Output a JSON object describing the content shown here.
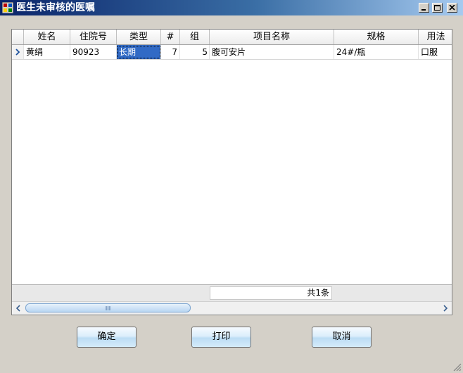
{
  "window": {
    "title": "医生未审核的医嘱"
  },
  "grid": {
    "columns": [
      {
        "key": "name",
        "label": "姓名"
      },
      {
        "key": "admission_no",
        "label": "住院号"
      },
      {
        "key": "type",
        "label": "类型"
      },
      {
        "key": "seq",
        "label": "#"
      },
      {
        "key": "group",
        "label": "组"
      },
      {
        "key": "item_name",
        "label": "项目名称"
      },
      {
        "key": "spec",
        "label": "规格"
      },
      {
        "key": "usage",
        "label": "用法"
      }
    ],
    "rows": [
      {
        "name": "黄绢",
        "admission_no": "90923",
        "type": "长期",
        "seq": "7",
        "group": "5",
        "item_name": "腹可安片",
        "spec": "24#/瓶",
        "usage": "口服"
      }
    ],
    "footer_count": "共1条"
  },
  "buttons": {
    "confirm": "确定",
    "print": "打印",
    "cancel": "取消"
  },
  "colors": {
    "selection": "#316ac5",
    "titlebar_start": "#0a246a",
    "titlebar_end": "#a6caf0"
  }
}
